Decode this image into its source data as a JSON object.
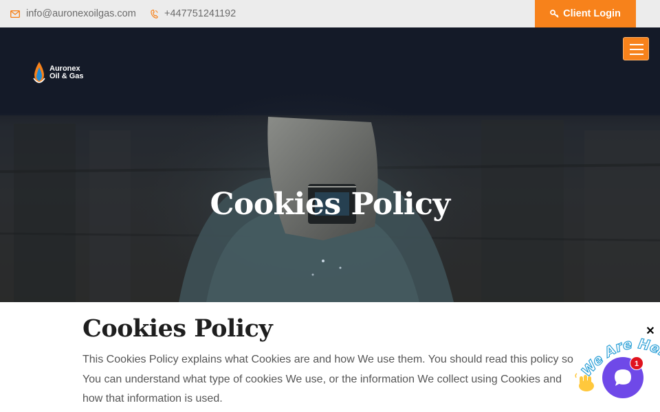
{
  "topbar": {
    "email": "info@auronexoilgas.com",
    "phone": "+447751241192",
    "login_label": "Client Login",
    "accent_color": "#f7821b"
  },
  "header": {
    "logo_line1": "Auronex",
    "logo_line2": "Oil & Gas",
    "menu_icon": "hamburger-icon"
  },
  "hero": {
    "title": "Cookies Policy"
  },
  "content": {
    "heading": "Cookies Policy",
    "paragraph": "This Cookies Policy explains what Cookies are and how We use them. You should read this policy so You can understand what type of cookies We use, or the information We collect using Cookies and how that information is used."
  },
  "chat": {
    "callout": "We Are Here!",
    "unread_count": "1",
    "close_label": "✕",
    "widget_color": "#6f49e8"
  }
}
